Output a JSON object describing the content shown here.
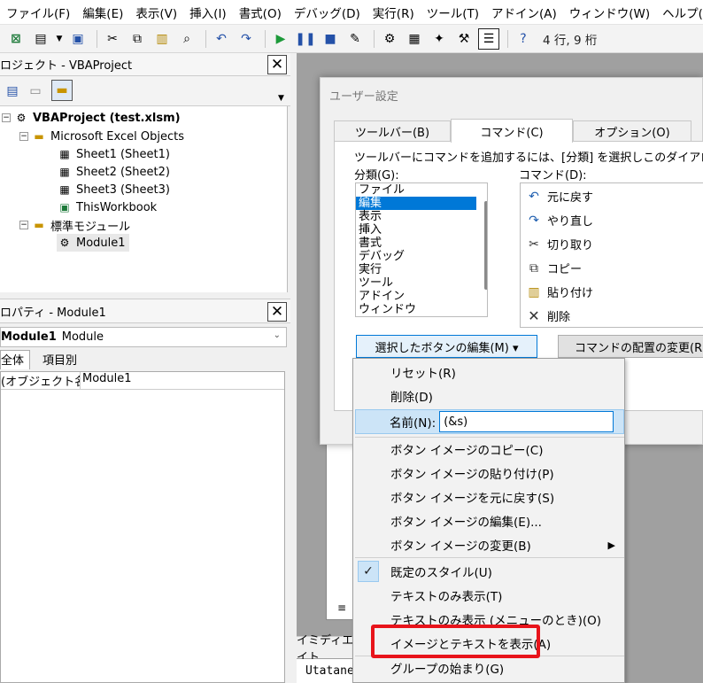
{
  "menu": [
    "ファイル(F)",
    "編集(E)",
    "表示(V)",
    "挿入(I)",
    "書式(O)",
    "デバッグ(D)",
    "実行(R)",
    "ツール(T)",
    "アドイン(A)",
    "ウィンドウ(W)",
    "ヘルプ(H"
  ],
  "toolbar": {
    "cursor_position": "4 行, 9 桁"
  },
  "project": {
    "title": "ロジェクト - VBAProject",
    "root": "VBAProject (test.xlsm)",
    "folder1": "Microsoft Excel Objects",
    "sheets": [
      "Sheet1 (Sheet1)",
      "Sheet2 (Sheet2)",
      "Sheet3 (Sheet3)"
    ],
    "workbook": "ThisWorkbook",
    "folder2": "標準モジュール",
    "module": "Module1"
  },
  "properties": {
    "title": "ロパティ - Module1",
    "object_name": "Module1",
    "object_type": "Module",
    "tabs": [
      "全体",
      "項目別"
    ],
    "row_key": "(オブジェクト名)",
    "row_value": "Module1"
  },
  "immediate": {
    "title": "イミディエイト",
    "text": "Utatane"
  },
  "dialog": {
    "title": "ユーザー設定",
    "tabs": [
      "ツールバー(B)",
      "コマンド(C)",
      "オプション(O)"
    ],
    "description": "ツールバーにコマンドを追加するには、[分類] を選択しこのダイアログ",
    "category_label": "分類(G):",
    "command_label": "コマンド(D):",
    "categories": [
      "ファイル",
      "編集",
      "表示",
      "挿入",
      "書式",
      "デバッグ",
      "実行",
      "ツール",
      "アドイン",
      "ウィンドウ"
    ],
    "commands": [
      "元に戻す",
      "やり直し",
      "切り取り",
      "コピー",
      "貼り付け",
      "削除"
    ],
    "edit_button": "選択したボタンの編集(M) ▾",
    "arrange_button": "コマンドの配置の変更(R)"
  },
  "context_menu": {
    "reset": "リセット(R)",
    "delete": "削除(D)",
    "name_label": "名前(N):",
    "name_value": "(&s)",
    "copy_image": "ボタン イメージのコピー(C)",
    "paste_image": "ボタン イメージの貼り付け(P)",
    "restore_image": "ボタン イメージを元に戻す(S)",
    "edit_image": "ボタン イメージの編集(E)...",
    "change_image": "ボタン イメージの変更(B)",
    "default_style": "既定のスタイル(U)",
    "text_only": "テキストのみ表示(T)",
    "text_only_menu": "テキストのみ表示 (メニューのとき)(O)",
    "image_and_text": "イメージとテキストを表示(A)",
    "begin_group": "グループの始まり(G)"
  },
  "highlight_color": "#e8141b"
}
